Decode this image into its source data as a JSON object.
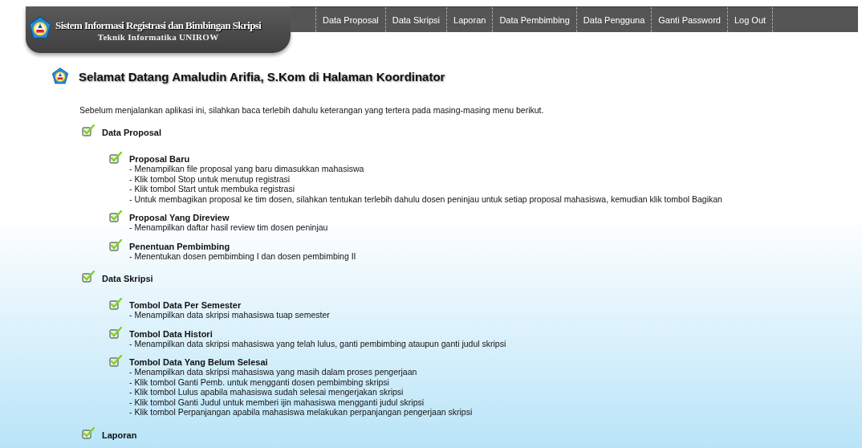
{
  "header": {
    "title": "Sistem Informasi Registrasi dan Bimbingan Skripsi",
    "subtitle": "Teknik Informatika UNIROW"
  },
  "nav": [
    {
      "label": "Data Proposal"
    },
    {
      "label": "Data Skripsi"
    },
    {
      "label": "Laporan"
    },
    {
      "label": "Data Pembimbing"
    },
    {
      "label": "Data Pengguna"
    },
    {
      "label": "Ganti Password"
    },
    {
      "label": "Log Out"
    }
  ],
  "heading": "Selamat Datang Amaludin Arifia, S.Kom di Halaman Koordinator",
  "intro": "Sebelum menjalankan aplikasi ini, silahkan baca terlebih dahulu keterangan yang tertera pada masing-masing menu berikut.",
  "sections": [
    {
      "title": "Data Proposal",
      "items": [
        {
          "title": "Proposal Baru",
          "lines": [
            "- Menampilkan file proposal yang baru dimasukkan mahasiswa",
            "- Klik tombol Stop untuk menutup registrasi",
            "- Klik tombol Start untuk membuka registrasi",
            "- Untuk membagikan proposal ke tim dosen, silahkan tentukan terlebih dahulu dosen peninjau untuk setiap proposal mahasiswa, kemudian klik tombol Bagikan"
          ]
        },
        {
          "title": "Proposal Yang Direview",
          "lines": [
            "- Menampilkan daftar hasil review tim dosen peninjau"
          ]
        },
        {
          "title": "Penentuan Pembimbing",
          "lines": [
            "- Menentukan dosen pembimbing I dan dosen pembimbing II"
          ]
        }
      ]
    },
    {
      "title": "Data Skripsi",
      "items": [
        {
          "title": "Tombol Data Per Semester",
          "lines": [
            "- Menampilkan data skripsi mahasiswa tuap semester"
          ]
        },
        {
          "title": "Tombol Data Histori",
          "lines": [
            "- Menampilkan data skripsi mahasiswa yang telah lulus, ganti pembimbing ataupun ganti judul skripsi"
          ]
        },
        {
          "title": "Tombol Data Yang Belum Selesai",
          "lines": [
            "- Menampilkan data skripsi mahasiswa yang masih dalam proses pengerjaan",
            "- Klik tombol Ganti Pemb. untuk mengganti dosen pembimbing skripsi",
            "- Klik tombol Lulus apabila mahasiswa sudah selesai mengerjakan skripsi",
            "- Klik tombol Ganti Judul untuk memberi ijin mahasiswa mengganti judul skripsi",
            "- Klik tombol Perpanjangan apabila mahasiswa melakukan perpanjangan pengerjaan skripsi"
          ]
        }
      ]
    },
    {
      "title": "Laporan"
    }
  ]
}
